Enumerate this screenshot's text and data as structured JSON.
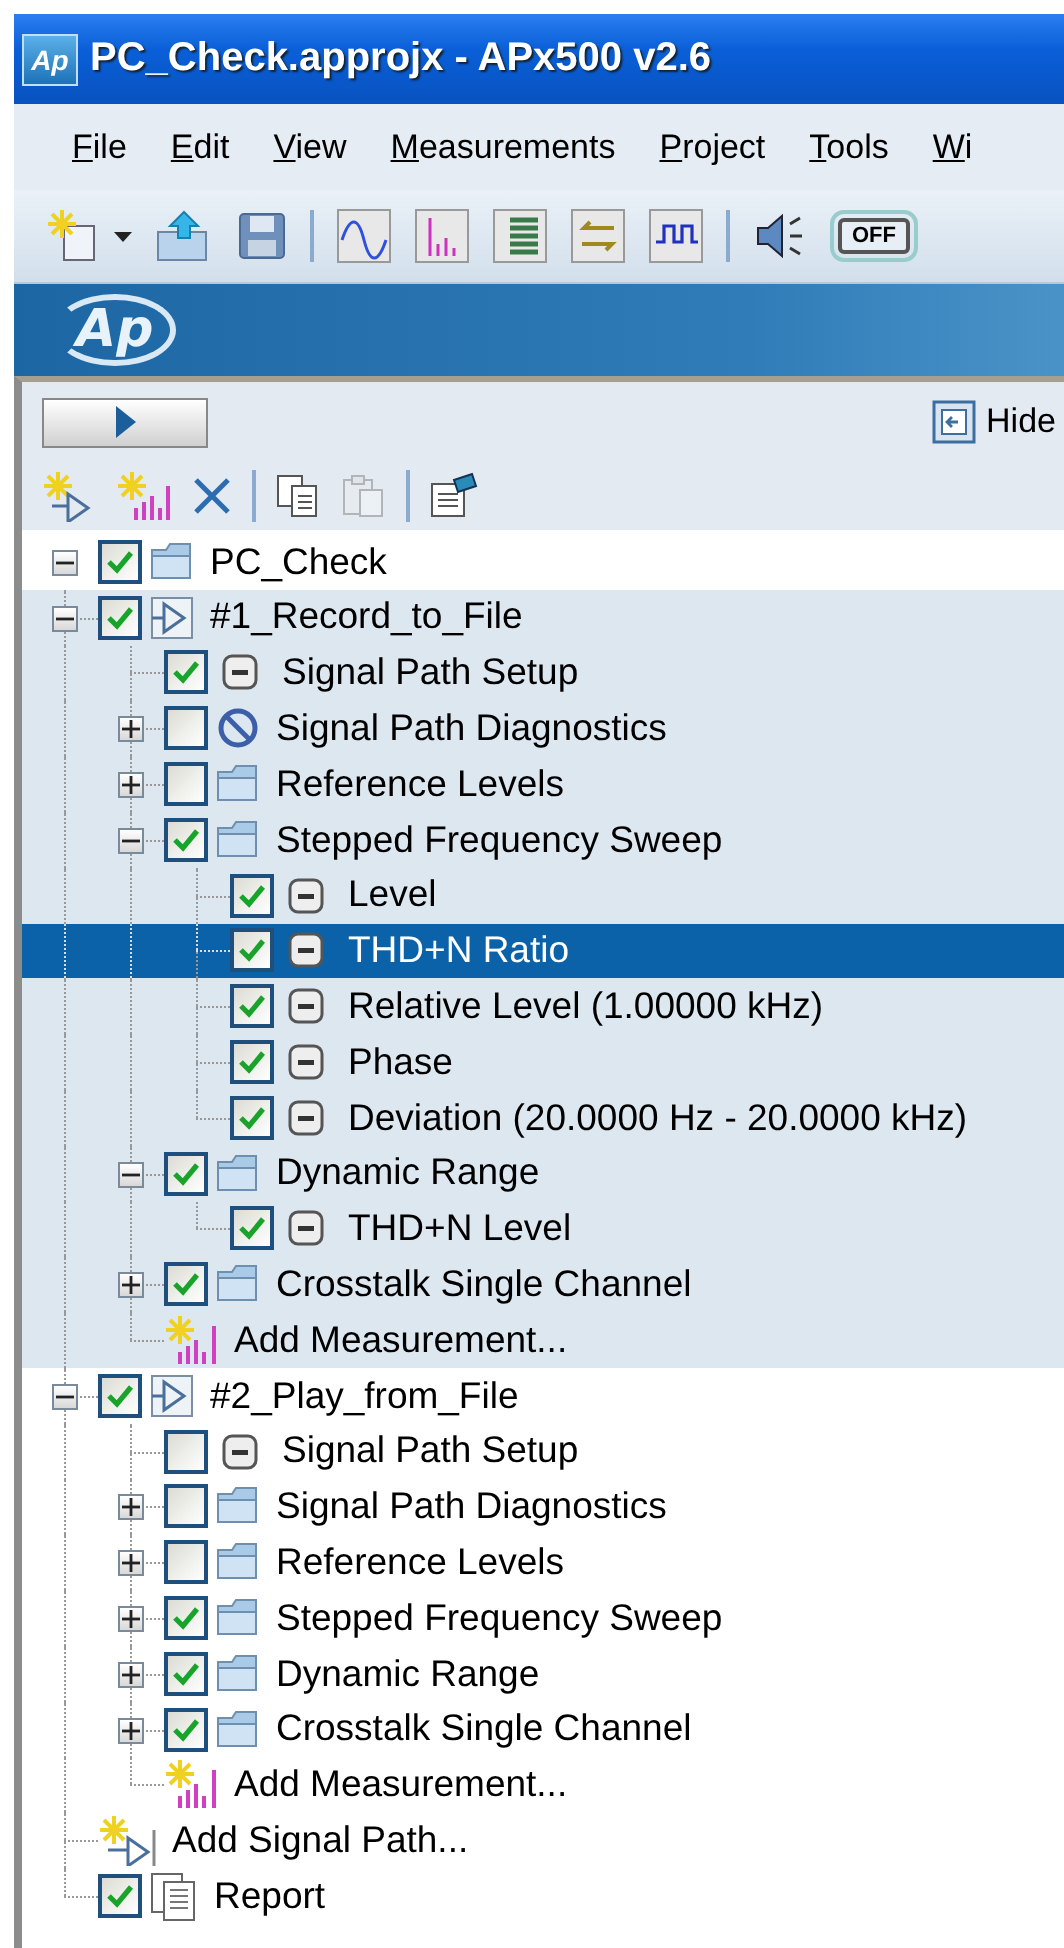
{
  "window": {
    "logo": "Ap",
    "title": "PC_Check.approjx - APx500 v2.6"
  },
  "menu": [
    "File",
    "Edit",
    "View",
    "Measurements",
    "Project",
    "Tools",
    "Wi"
  ],
  "toolbar": [
    {
      "kind": "new"
    },
    {
      "kind": "dropdown"
    },
    {
      "kind": "open"
    },
    {
      "kind": "save"
    },
    {
      "kind": "separator"
    },
    {
      "kind": "sine"
    },
    {
      "kind": "spectrum"
    },
    {
      "kind": "table"
    },
    {
      "kind": "swap"
    },
    {
      "kind": "square"
    },
    {
      "kind": "separator"
    },
    {
      "kind": "speaker"
    },
    {
      "kind": "toggle",
      "label": "OFF"
    }
  ],
  "banner": {
    "logo": "Ap"
  },
  "panel": {
    "hide_label": "Hide",
    "toolbar": [
      {
        "kind": "add_path",
        "disabled": false
      },
      {
        "kind": "add_measurement",
        "disabled": false
      },
      {
        "kind": "delete",
        "disabled": false
      },
      {
        "kind": "separator"
      },
      {
        "kind": "copy",
        "disabled": false
      },
      {
        "kind": "paste",
        "disabled": true
      },
      {
        "kind": "separator"
      },
      {
        "kind": "properties",
        "disabled": false
      }
    ]
  },
  "tree": {
    "label": "PC_Check",
    "kind": "project",
    "checked": true,
    "expanded": true,
    "selected": false,
    "children": [
      {
        "label": "#1_Record_to_File",
        "kind": "signal_path",
        "checked": true,
        "expanded": true,
        "selected": false,
        "active": true,
        "children": [
          {
            "label": "Signal Path Setup",
            "kind": "measurement",
            "checked": true,
            "selected": false
          },
          {
            "label": "Signal Path Diagnostics",
            "kind": "blocked",
            "checked": false,
            "expanded": false,
            "selected": false
          },
          {
            "label": "Reference Levels",
            "kind": "folder",
            "checked": false,
            "expanded": false,
            "selected": false
          },
          {
            "label": "Stepped Frequency Sweep",
            "kind": "folder",
            "checked": true,
            "expanded": true,
            "selected": false,
            "children": [
              {
                "label": "Level",
                "kind": "measurement",
                "checked": true,
                "selected": false
              },
              {
                "label": "THD+N Ratio",
                "kind": "measurement",
                "checked": true,
                "selected": true
              },
              {
                "label": "Relative Level (1.00000 kHz)",
                "kind": "measurement",
                "checked": true,
                "selected": false
              },
              {
                "label": "Phase",
                "kind": "measurement",
                "checked": true,
                "selected": false
              },
              {
                "label": "Deviation (20.0000 Hz - 20.0000 kHz)",
                "kind": "measurement",
                "checked": true,
                "selected": false
              }
            ]
          },
          {
            "label": "Dynamic Range",
            "kind": "folder",
            "checked": true,
            "expanded": true,
            "selected": false,
            "children": [
              {
                "label": "THD+N Level",
                "kind": "measurement",
                "checked": true,
                "selected": false
              }
            ]
          },
          {
            "label": "Crosstalk Single Channel",
            "kind": "folder",
            "checked": true,
            "expanded": false,
            "selected": false
          },
          {
            "label": "Add Measurement...",
            "kind": "add_measurement",
            "selected": false
          }
        ]
      },
      {
        "label": "#2_Play_from_File",
        "kind": "signal_path",
        "checked": true,
        "expanded": true,
        "selected": false,
        "active": false,
        "children": [
          {
            "label": "Signal Path Setup",
            "kind": "measurement",
            "checked": false,
            "selected": false
          },
          {
            "label": "Signal Path Diagnostics",
            "kind": "folder",
            "checked": false,
            "expanded": false,
            "selected": false
          },
          {
            "label": "Reference Levels",
            "kind": "folder",
            "checked": false,
            "expanded": false,
            "selected": false
          },
          {
            "label": "Stepped Frequency Sweep",
            "kind": "folder",
            "checked": true,
            "expanded": false,
            "selected": false
          },
          {
            "label": "Dynamic Range",
            "kind": "folder",
            "checked": true,
            "expanded": false,
            "selected": false
          },
          {
            "label": "Crosstalk Single Channel",
            "kind": "folder",
            "checked": true,
            "expanded": false,
            "selected": false
          },
          {
            "label": "Add Measurement...",
            "kind": "add_measurement",
            "selected": false
          }
        ]
      },
      {
        "label": "Add Signal Path...",
        "kind": "add_signal_path",
        "selected": false
      },
      {
        "label": "Report",
        "kind": "report",
        "checked": true,
        "selected": false
      }
    ]
  }
}
